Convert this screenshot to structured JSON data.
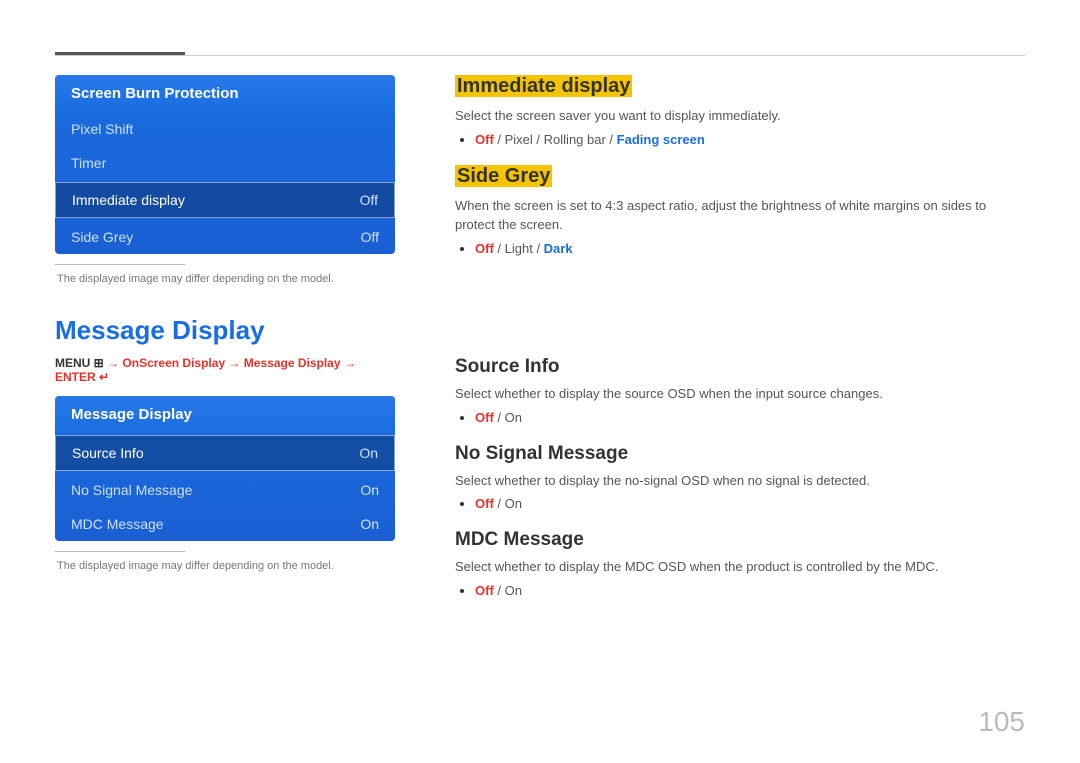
{
  "top": {
    "divider": true
  },
  "section1": {
    "panel": {
      "header": "Screen Burn Protection",
      "items": [
        {
          "label": "Pixel Shift",
          "value": "",
          "selected": false
        },
        {
          "label": "Timer",
          "value": "",
          "selected": false
        },
        {
          "label": "Immediate display",
          "value": "Off",
          "selected": true
        },
        {
          "label": "Side Grey",
          "value": "Off",
          "selected": false
        }
      ]
    },
    "note_divider": true,
    "note": "The displayed image may differ depending on the model.",
    "right": {
      "immediate_display": {
        "title": "Immediate display",
        "desc": "Select the screen saver you want to display immediately.",
        "options_text": "Off / Pixel / Rolling bar / Fading screen",
        "options": [
          {
            "text": "Off",
            "type": "off"
          },
          {
            "text": " / ",
            "type": "sep"
          },
          {
            "text": "Pixel",
            "type": "normal"
          },
          {
            "text": " / ",
            "type": "sep"
          },
          {
            "text": "Rolling bar",
            "type": "normal"
          },
          {
            "text": " / ",
            "type": "sep"
          },
          {
            "text": "Fading screen",
            "type": "highlight"
          }
        ]
      },
      "side_grey": {
        "title": "Side Grey",
        "desc": "When the screen is set to 4:3 aspect ratio, adjust the brightness of white margins on sides to protect the screen.",
        "options": [
          {
            "text": "Off",
            "type": "off"
          },
          {
            "text": " / ",
            "type": "sep"
          },
          {
            "text": "Light",
            "type": "normal"
          },
          {
            "text": " / ",
            "type": "sep"
          },
          {
            "text": "Dark",
            "type": "highlight"
          }
        ]
      }
    }
  },
  "section2": {
    "title": "Message Display",
    "breadcrumb": {
      "parts": [
        {
          "text": "MENU ",
          "type": "normal"
        },
        {
          "text": "III",
          "type": "normal"
        },
        {
          "text": " → ",
          "type": "arrow"
        },
        {
          "text": "OnScreen Display",
          "type": "highlight"
        },
        {
          "text": " → ",
          "type": "arrow"
        },
        {
          "text": "Message Display",
          "type": "highlight"
        },
        {
          "text": " → ENTER ",
          "type": "arrow"
        },
        {
          "text": "↵",
          "type": "arrow"
        }
      ]
    },
    "panel": {
      "header": "Message Display",
      "items": [
        {
          "label": "Source Info",
          "value": "On",
          "selected": true
        },
        {
          "label": "No Signal Message",
          "value": "On",
          "selected": false
        },
        {
          "label": "MDC Message",
          "value": "On",
          "selected": false
        }
      ]
    },
    "note": "The displayed image may differ depending on the model.",
    "right": {
      "source_info": {
        "title": "Source Info",
        "desc": "Select whether to display the source OSD when the input source changes.",
        "options": [
          {
            "text": "Off",
            "type": "off"
          },
          {
            "text": " / ",
            "type": "sep"
          },
          {
            "text": "On",
            "type": "normal"
          }
        ]
      },
      "no_signal": {
        "title": "No Signal Message",
        "desc": "Select whether to display the no-signal OSD when no signal is detected.",
        "options": [
          {
            "text": "Off",
            "type": "off"
          },
          {
            "text": " / ",
            "type": "sep"
          },
          {
            "text": "On",
            "type": "normal"
          }
        ]
      },
      "mdc_message": {
        "title": "MDC Message",
        "desc": "Select whether to display the MDC OSD when the product is controlled by the MDC.",
        "options": [
          {
            "text": "Off",
            "type": "off"
          },
          {
            "text": " / ",
            "type": "sep"
          },
          {
            "text": "On",
            "type": "normal"
          }
        ]
      }
    }
  },
  "page_number": "105"
}
